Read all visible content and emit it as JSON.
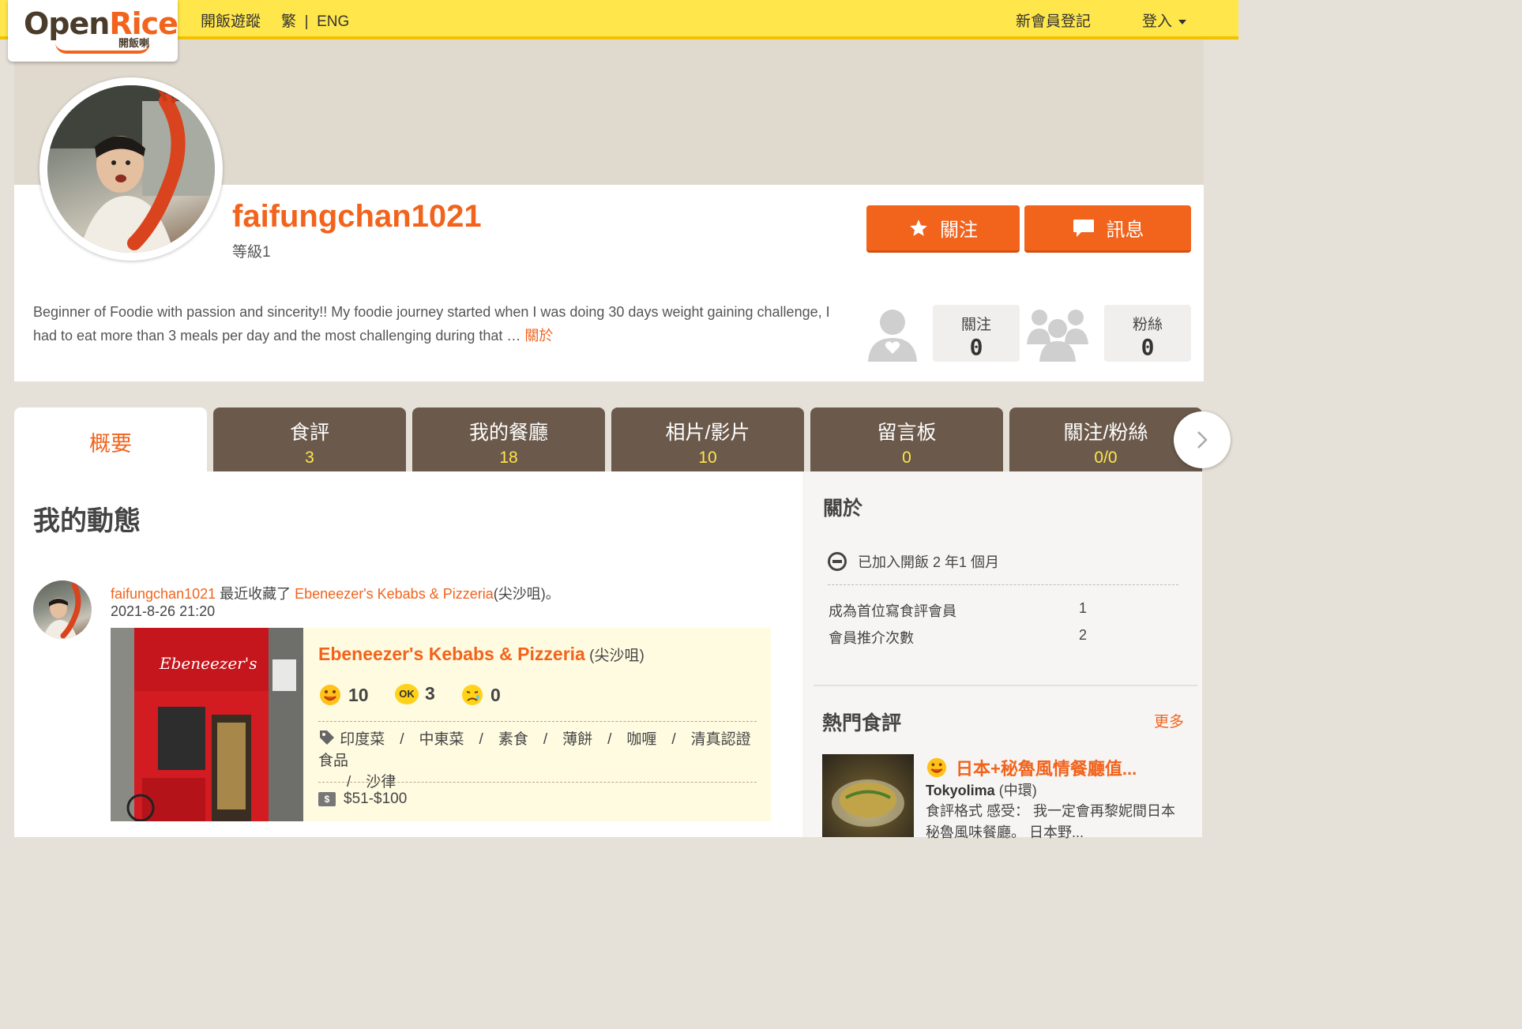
{
  "header": {
    "logo": "OpenRice 開飯喇",
    "logo_main_1": "Open",
    "logo_main_2": "Rice",
    "logo_sub": "開飯喇",
    "tracking": "開飯遊蹤",
    "lang_trad": "繁",
    "lang_sep": "|",
    "lang_eng": "ENG",
    "register": "新會員登記",
    "login": "登入"
  },
  "profile": {
    "username": "faifungchan1021",
    "level": "等級1",
    "follow_button": "關注",
    "message_button": "訊息",
    "bio": "Beginner of Foodie with passion and sincerity!! My foodie journey started when I was doing 30 days weight gaining challenge, I had to eat more than 3 meals per day and the most challenging during that …",
    "bio_more": "關於",
    "stats": {
      "following_label": "關注",
      "following_value": "0",
      "fans_label": "粉絲",
      "fans_value": "0"
    }
  },
  "tabs": [
    {
      "label": "概要",
      "count": ""
    },
    {
      "label": "食評",
      "count": "3"
    },
    {
      "label": "我的餐廳",
      "count": "18"
    },
    {
      "label": "相片/影片",
      "count": "10"
    },
    {
      "label": "留言板",
      "count": "0"
    },
    {
      "label": "關注/粉絲",
      "count": "0/0"
    }
  ],
  "activity": {
    "section_title": "我的動態",
    "user": "faifungchan1021",
    "action": " 最近收藏了 ",
    "restaurant_link": "Ebeneezer's Kebabs & Pizzeria",
    "restaurant_district_inline": "(尖沙咀)。",
    "date": "2021-8-26 21:20",
    "card": {
      "name": "Ebeneezer's Kebabs & Pizzeria",
      "district": " (尖沙咀)",
      "smile": "10",
      "ok": "3",
      "cry": "0",
      "ok_badge": "OK",
      "cuisines_line1": "印度菜　/　中東菜　/　素食　/　薄餅　/　咖喱　/　清真認證食品",
      "cuisines_line2": "/　沙律",
      "price": "$51-$100",
      "dollar_glyph": "$"
    }
  },
  "sidebar": {
    "about_title": "關於",
    "joined": "已加入開飯 2 年1 個月",
    "rows": [
      {
        "label": "成為首位寫食評會員",
        "value": "1"
      },
      {
        "label": "會員推介次數",
        "value": "2"
      }
    ],
    "hot_title": "熱門食評",
    "more": "更多",
    "hot_review": {
      "title": "日本+秘魯風情餐廳值...",
      "restaurant": "Tokyolima",
      "district": " (中環)",
      "snippet": "食評格式 感受： 我一定會再黎妮間日本秘魯風味餐廳。 日本野..."
    }
  }
}
